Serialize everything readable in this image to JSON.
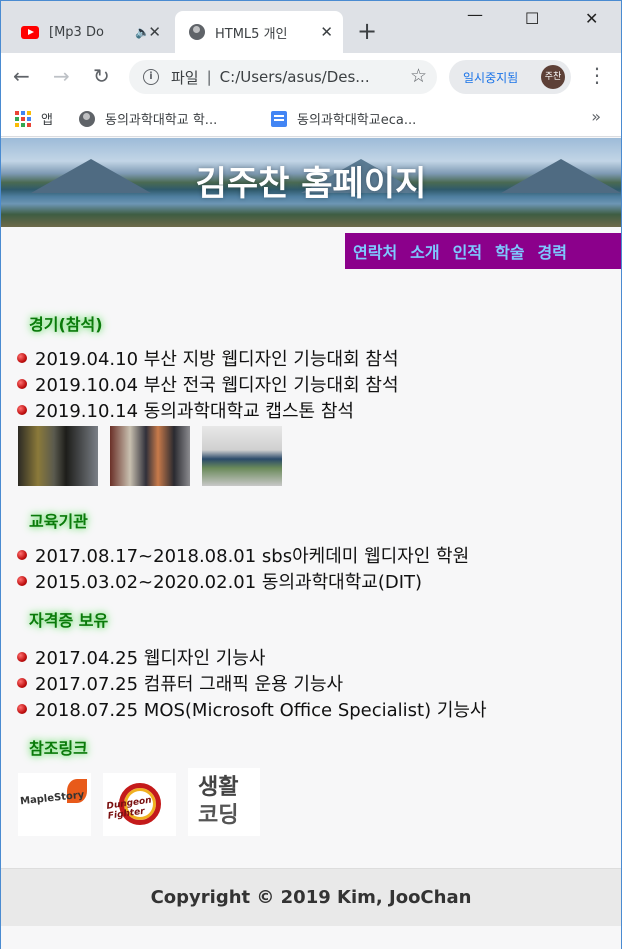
{
  "browser": {
    "tabs": [
      {
        "title": "[Mp3 Do",
        "icon": "youtube-icon"
      },
      {
        "title": "HTML5 개인",
        "icon": "globe-icon"
      }
    ],
    "new_tab": "+",
    "window": {
      "minimize": "—",
      "maximize": "☐",
      "close": "✕"
    },
    "address": {
      "label": "파일",
      "url": "C:/Users/asus/Des..."
    },
    "profile": {
      "status": "일시중지됨",
      "avatar_text": "주찬"
    },
    "bookmarks": [
      {
        "label": "앱",
        "icon": "apps-icon"
      },
      {
        "label": "동의과학대학교 학...",
        "icon": "globe-icon"
      },
      {
        "label": "동의과학대학교eca...",
        "icon": "memo-icon"
      }
    ],
    "bookmarks_more": "»"
  },
  "site": {
    "title": "김주찬 홈페이지",
    "nav": [
      "연락처",
      "소개",
      "인적",
      "학술",
      "경력"
    ],
    "sections": {
      "competitions": {
        "title": "경기(참석)",
        "items": [
          "2019.04.10 부산 지방 웹디자인 기능대회 참석",
          "2019.10.04 부산 전국 웹디자인 기능대회 참석",
          "2019.10.14 동의과학대학교 캡스톤 참석"
        ]
      },
      "education": {
        "title": "교육기관",
        "items": [
          "2017.08.17~2018.08.01 sbs아케데미 웹디자인 학원",
          "2015.03.02~2020.02.01 동의과학대학교(DIT)"
        ]
      },
      "certificates": {
        "title": "자격증 보유",
        "items": [
          "2017.04.25 웹디자인 기능사",
          "2017.07.25 컴퓨터 그래픽 운용 기능사",
          "2018.07.25 MOS(Microsoft Office Specialist) 기능사"
        ]
      },
      "links": {
        "title": "참조링크",
        "logos": [
          {
            "name": "maplestory-logo",
            "text": "MapleStory"
          },
          {
            "name": "dungeon-fighter-logo",
            "text": "Dungeon Fighter"
          },
          {
            "name": "coding-logo",
            "text_top": "생활",
            "text_bottom": "코딩"
          }
        ]
      }
    },
    "footer": "Copyright © 2019 Kim, JooChan"
  }
}
